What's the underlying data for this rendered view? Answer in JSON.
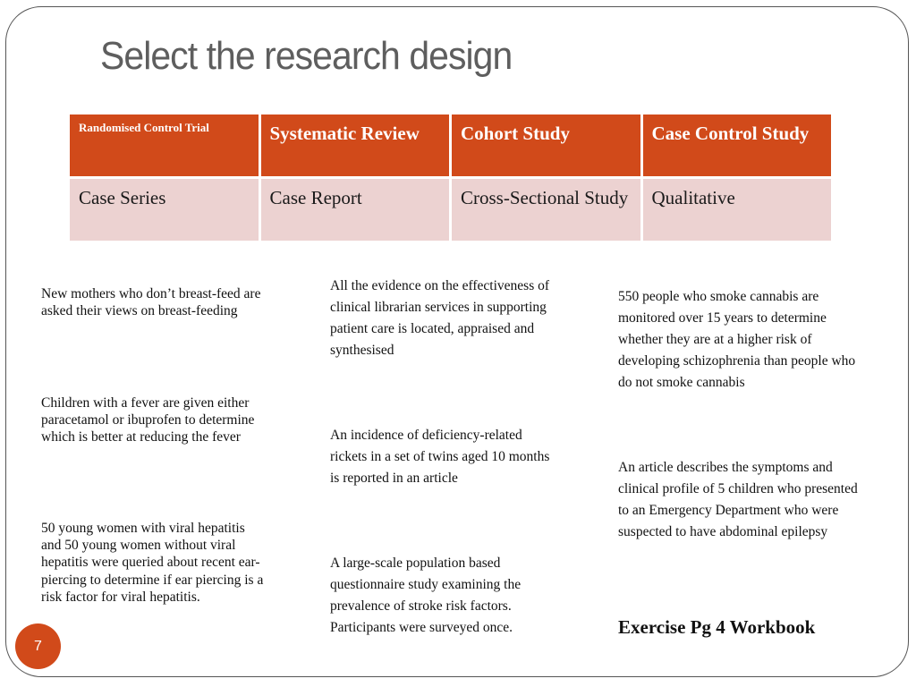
{
  "slide": {
    "title": "Select the research design",
    "page_number": "7",
    "exercise_note": "Exercise Pg 4 Workbook"
  },
  "design_table": {
    "rows": [
      [
        "Randomised Control Trial",
        "Systematic Review",
        "Cohort Study",
        "Case Control Study"
      ],
      [
        "Case Series",
        "Case Report",
        "Cross-Sectional Study",
        "Qualitative"
      ]
    ]
  },
  "scenarios": {
    "left": [
      "New mothers who don’t breast-feed are asked their views on breast-feeding",
      "Children with a fever are given either paracetamol or ibuprofen to determine which is better at reducing the fever",
      "50 young women with viral hepatitis and 50 young women without viral hepatitis were queried about recent ear-piercing to determine if ear piercing is a risk factor for viral hepatitis."
    ],
    "middle": [
      "All the evidence on the effectiveness of clinical librarian services in supporting patient care is located, appraised and synthesised",
      "An incidence of deficiency-related rickets in a set of twins aged 10 months is reported in an article",
      "A large-scale population based questionnaire study examining the prevalence of stroke risk factors. Participants were surveyed once."
    ],
    "right": [
      "550 people who smoke cannabis are monitored over 15 years to determine whether they are at a higher risk of developing schizophrenia than people who do not smoke cannabis",
      "An article describes the symptoms and clinical profile of 5 children who presented to an Emergency Department who were suspected to have abdominal epilepsy"
    ]
  },
  "colors": {
    "accent": "#d14a1a",
    "row_fill": "#ecd2d1",
    "title_text": "#5e5e5e"
  }
}
